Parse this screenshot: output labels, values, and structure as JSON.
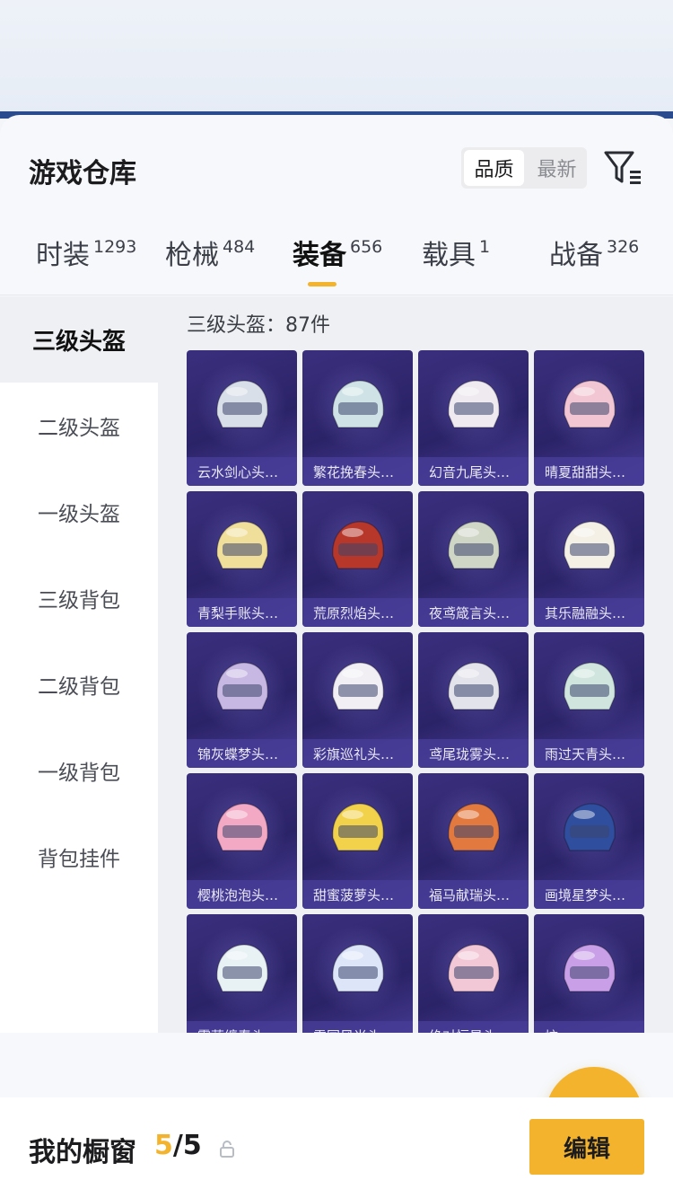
{
  "sheet": {
    "title": "游戏仓库",
    "sort": [
      "品质",
      "最新"
    ],
    "sort_active": 0
  },
  "tabs": [
    {
      "label": "时装",
      "count": "1293"
    },
    {
      "label": "枪械",
      "count": "484"
    },
    {
      "label": "装备",
      "count": "656",
      "active": true
    },
    {
      "label": "载具",
      "count": "1"
    },
    {
      "label": "战备",
      "count": "326"
    }
  ],
  "sidebar": {
    "items": [
      {
        "label": "三级头盔",
        "active": true
      },
      {
        "label": "二级头盔"
      },
      {
        "label": "一级头盔"
      },
      {
        "label": "三级背包"
      },
      {
        "label": "二级背包"
      },
      {
        "label": "一级背包"
      },
      {
        "label": "背包挂件"
      }
    ]
  },
  "grid": {
    "count_label": "三级头盔：87件",
    "items": [
      {
        "name": "云水剑心头…",
        "color": "#d9dfe8"
      },
      {
        "name": "繁花挽春头…",
        "color": "#cfe3e6"
      },
      {
        "name": "幻音九尾头…",
        "color": "#eeeaf0"
      },
      {
        "name": "晴夏甜甜头…",
        "color": "#f2c7d3"
      },
      {
        "name": "青梨手账头…",
        "color": "#f0df9a"
      },
      {
        "name": "荒原烈焰头…",
        "color": "#b7382a"
      },
      {
        "name": "夜鸢箴言头…",
        "color": "#cfd6c6"
      },
      {
        "name": "其乐融融头…",
        "color": "#f4f0e6"
      },
      {
        "name": "锦灰蝶梦头…",
        "color": "#c7b7e3"
      },
      {
        "name": "彩旗巡礼头…",
        "color": "#f1eef4"
      },
      {
        "name": "鸢尾珑雾头…",
        "color": "#e3e3ec"
      },
      {
        "name": "雨过天青头…",
        "color": "#cfe5de"
      },
      {
        "name": "樱桃泡泡头…",
        "color": "#f3a8c4"
      },
      {
        "name": "甜蜜菠萝头…",
        "color": "#f1d24a"
      },
      {
        "name": "福马献瑞头…",
        "color": "#e2793e"
      },
      {
        "name": "画境星梦头…",
        "color": "#2f4e9e"
      },
      {
        "name": "雾蓝缠春头…",
        "color": "#e8f1f4"
      },
      {
        "name": "雪国风尚头…",
        "color": "#dce6f8"
      },
      {
        "name": "绝对恒星头…",
        "color": "#f2c8d6"
      },
      {
        "name": "炫…",
        "color": "#c9a0e8"
      }
    ]
  },
  "bottom": {
    "window_label": "我的橱窗",
    "current": "5",
    "total": "/5",
    "edit_label": "编辑"
  },
  "colors": {
    "accent": "#f3b32c",
    "card": "#2f2670"
  }
}
